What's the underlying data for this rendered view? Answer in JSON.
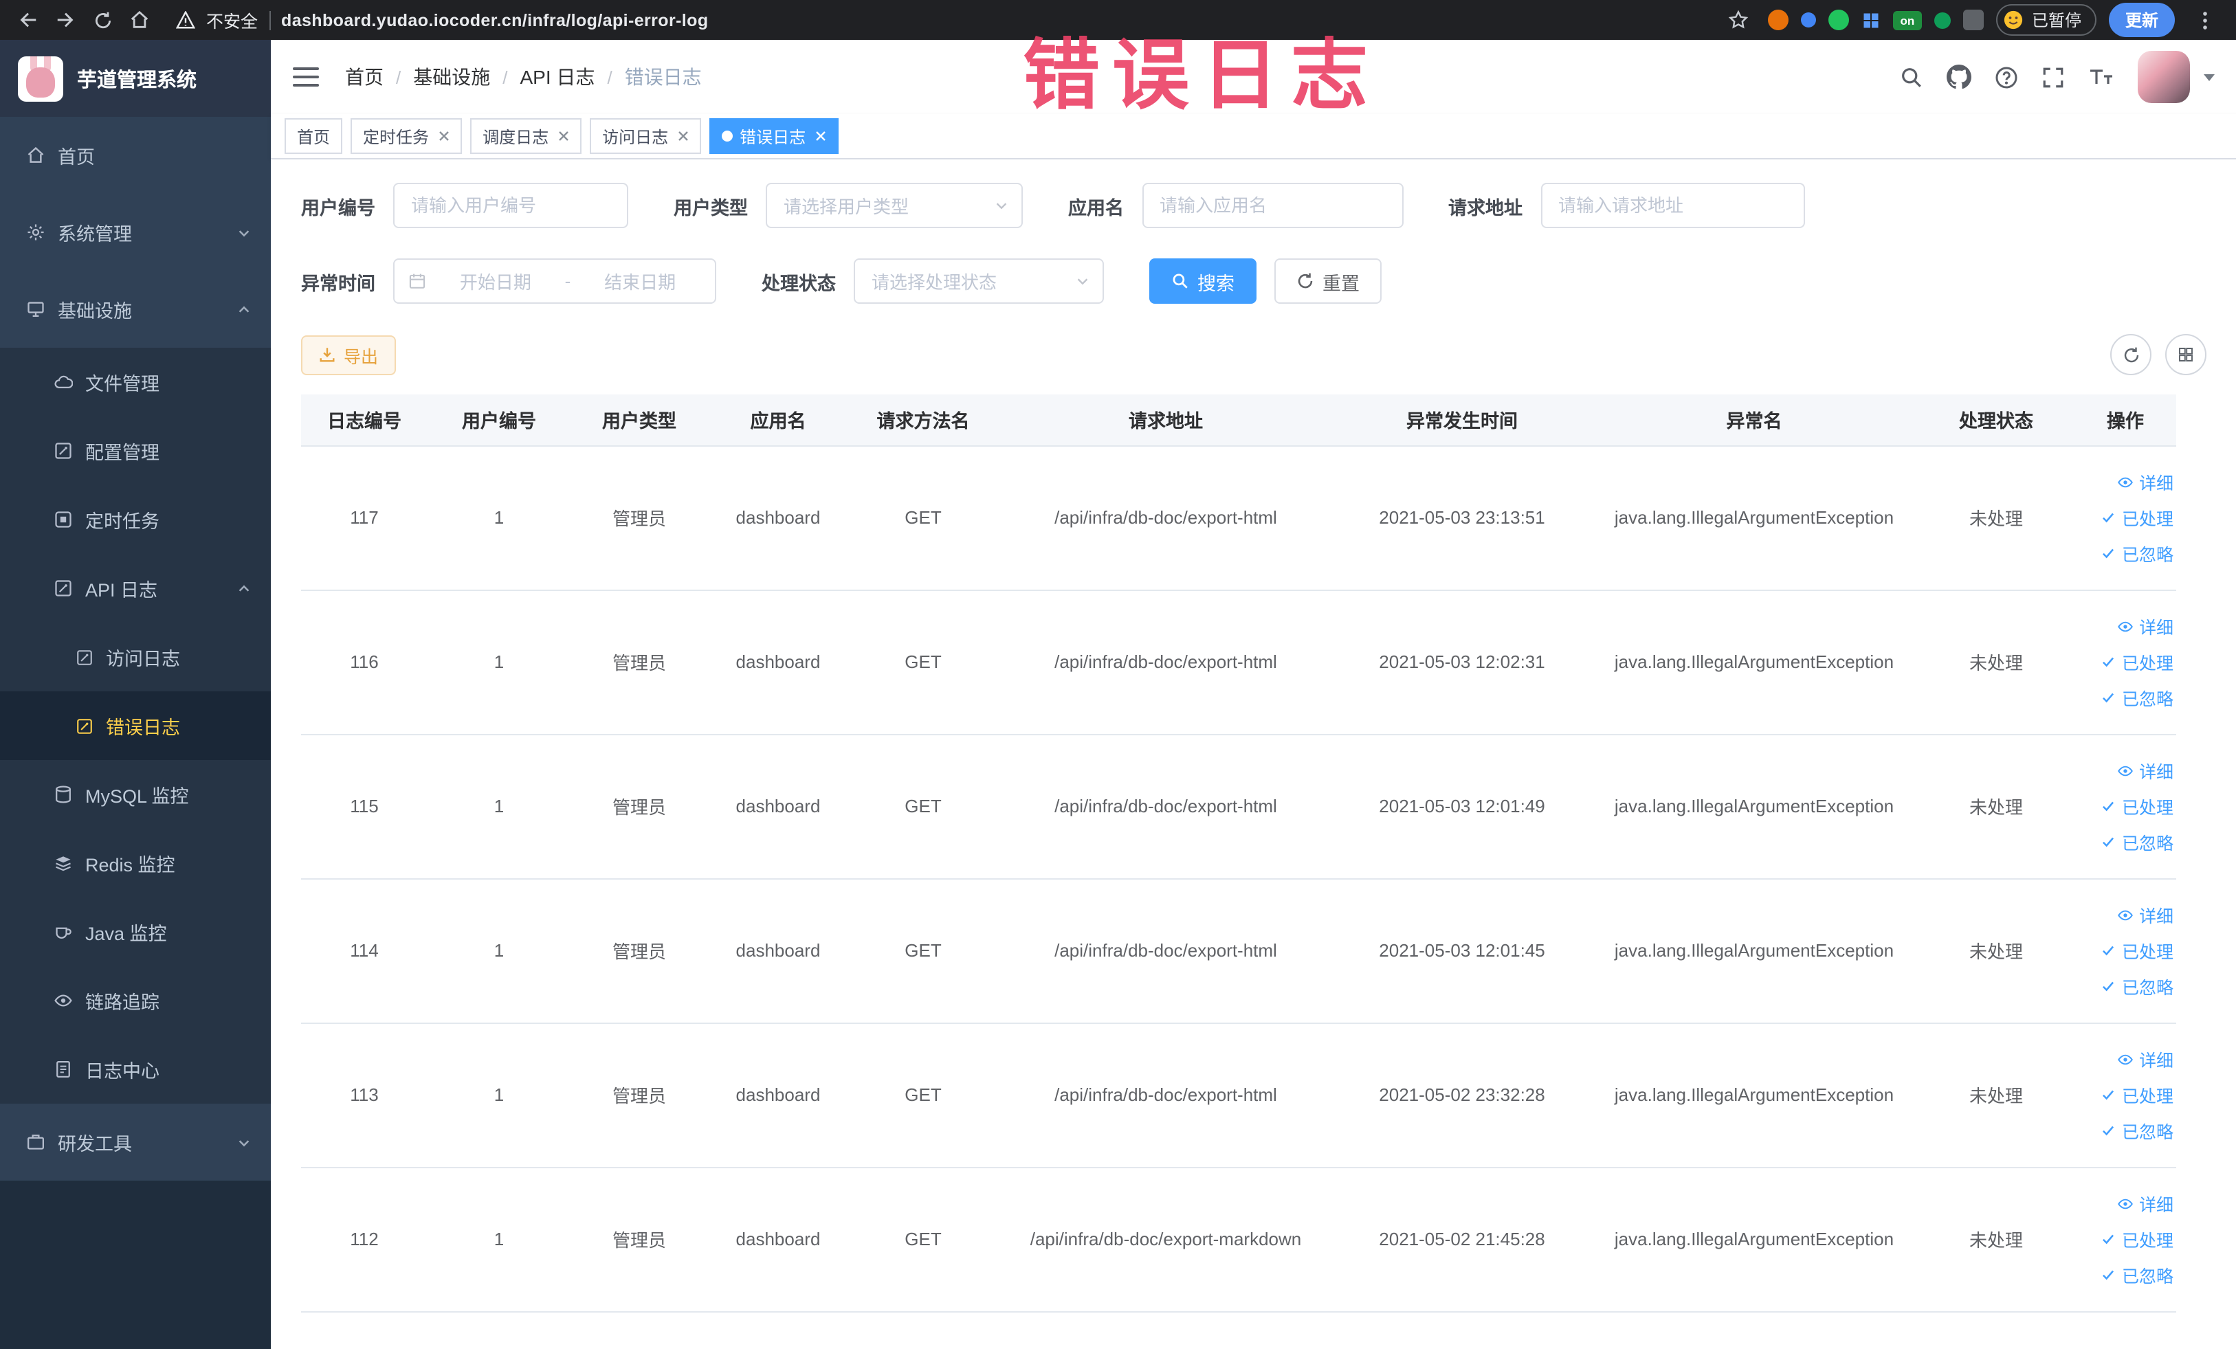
{
  "annotation": {
    "text": "错误日志"
  },
  "browser": {
    "security_label": "不安全",
    "url": "dashboard.yudao.iocoder.cn/infra/log/api-error-log",
    "extension_badge": "on",
    "paused_label": "已暂停",
    "update_label": "更新"
  },
  "sidebar": {
    "app_title": "芋道管理系统",
    "items": [
      {
        "label": "首页"
      },
      {
        "label": "系统管理"
      },
      {
        "label": "基础设施"
      },
      {
        "label": "文件管理"
      },
      {
        "label": "配置管理"
      },
      {
        "label": "定时任务"
      },
      {
        "label": "API 日志"
      },
      {
        "label": "访问日志"
      },
      {
        "label": "错误日志"
      },
      {
        "label": "MySQL 监控"
      },
      {
        "label": "Redis 监控"
      },
      {
        "label": "Java 监控"
      },
      {
        "label": "链路追踪"
      },
      {
        "label": "日志中心"
      },
      {
        "label": "研发工具"
      }
    ]
  },
  "breadcrumb": [
    "首页",
    "基础设施",
    "API 日志",
    "错误日志"
  ],
  "tabs": [
    {
      "label": "首页"
    },
    {
      "label": "定时任务"
    },
    {
      "label": "调度日志"
    },
    {
      "label": "访问日志"
    },
    {
      "label": "错误日志"
    }
  ],
  "filters": {
    "user_id_label": "用户编号",
    "user_id_placeholder": "请输入用户编号",
    "user_type_label": "用户类型",
    "user_type_placeholder": "请选择用户类型",
    "app_name_label": "应用名",
    "app_name_placeholder": "请输入应用名",
    "request_url_label": "请求地址",
    "request_url_placeholder": "请输入请求地址",
    "exception_time_label": "异常时间",
    "start_date_placeholder": "开始日期",
    "range_separator": "-",
    "end_date_placeholder": "结束日期",
    "process_status_label": "处理状态",
    "process_status_placeholder": "请选择处理状态",
    "search_label": "搜索",
    "reset_label": "重置"
  },
  "toolbar": {
    "export_label": "导出"
  },
  "table": {
    "columns": [
      "日志编号",
      "用户编号",
      "用户类型",
      "应用名",
      "请求方法名",
      "请求地址",
      "异常发生时间",
      "异常名",
      "处理状态",
      "操作"
    ],
    "action_labels": {
      "detail": "详细",
      "processed": "已处理",
      "ignored": "已忽略"
    },
    "rows": [
      {
        "id": "117",
        "user_id": "1",
        "user_type": "管理员",
        "app": "dashboard",
        "method": "GET",
        "url": "/api/infra/db-doc/export-html",
        "time": "2021-05-03 23:13:51",
        "exception": "java.lang.IllegalArgumentException",
        "status": "未处理"
      },
      {
        "id": "116",
        "user_id": "1",
        "user_type": "管理员",
        "app": "dashboard",
        "method": "GET",
        "url": "/api/infra/db-doc/export-html",
        "time": "2021-05-03 12:02:31",
        "exception": "java.lang.IllegalArgumentException",
        "status": "未处理"
      },
      {
        "id": "115",
        "user_id": "1",
        "user_type": "管理员",
        "app": "dashboard",
        "method": "GET",
        "url": "/api/infra/db-doc/export-html",
        "time": "2021-05-03 12:01:49",
        "exception": "java.lang.IllegalArgumentException",
        "status": "未处理"
      },
      {
        "id": "114",
        "user_id": "1",
        "user_type": "管理员",
        "app": "dashboard",
        "method": "GET",
        "url": "/api/infra/db-doc/export-html",
        "time": "2021-05-03 12:01:45",
        "exception": "java.lang.IllegalArgumentException",
        "status": "未处理"
      },
      {
        "id": "113",
        "user_id": "1",
        "user_type": "管理员",
        "app": "dashboard",
        "method": "GET",
        "url": "/api/infra/db-doc/export-html",
        "time": "2021-05-02 23:32:28",
        "exception": "java.lang.IllegalArgumentException",
        "status": "未处理"
      },
      {
        "id": "112",
        "user_id": "1",
        "user_type": "管理员",
        "app": "dashboard",
        "method": "GET",
        "url": "/api/infra/db-doc/export-markdown",
        "time": "2021-05-02 21:45:28",
        "exception": "java.lang.IllegalArgumentException",
        "status": "未处理"
      }
    ]
  }
}
